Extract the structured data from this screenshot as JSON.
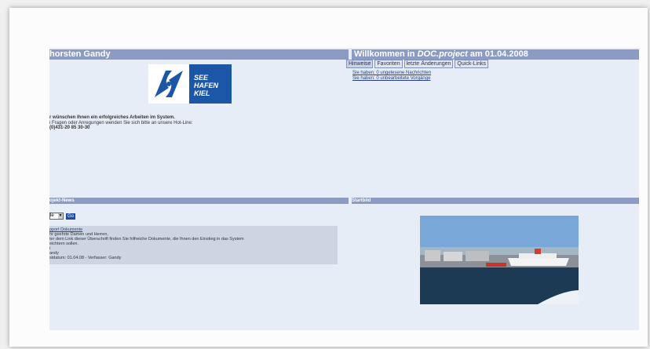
{
  "header": {
    "user_name": "horsten Gandy",
    "welcome_prefix": "Willkommen in ",
    "welcome_product": "DOC.project",
    "welcome_suffix": " am 01.04.2008"
  },
  "tabs": [
    "Hinweise",
    "Favoriten",
    "letzte Änderungen",
    "Quick-Links"
  ],
  "messages": [
    "Sie haben: 0 ungelesene Nachrichten",
    "Sie haben: 0 unbearbeitete Vorgänge"
  ],
  "logo": {
    "line1": "SEE",
    "line2": "HAFEN",
    "line3": "KIEL",
    "colors": {
      "blue": "#1c56a6"
    }
  },
  "welcome_text": {
    "line1": "r wünschen Ihnen ein erfolgreiches Arbeiten im System.",
    "line2": "i Fragen oder Anregungen wenden Sie sich bitte an unsere Hot-Line:",
    "line3": "(0)431-20 85 30-30"
  },
  "news": {
    "heading": "ojekt-News",
    "select_value": "le",
    "go_label": "Go",
    "item": {
      "title": "pport Dokumente",
      "line1": "hr geehrte Damen und Herren,",
      "line2": "ter dem Link dieser Überschrift finden Sie hilfreiche Dokumente, die Ihnen den Einstieg in das System",
      "line3": "eichtern sollen.",
      "line4": "i",
      "line5": "andy",
      "line6": "stdatum: 01.04.08 - Verfasser: Gandy"
    }
  },
  "startbild": {
    "heading": "Startbild"
  },
  "colors": {
    "bar": "#8b9bc3",
    "panel": "#e7edf7",
    "news_bg": "#cdd5e3"
  }
}
